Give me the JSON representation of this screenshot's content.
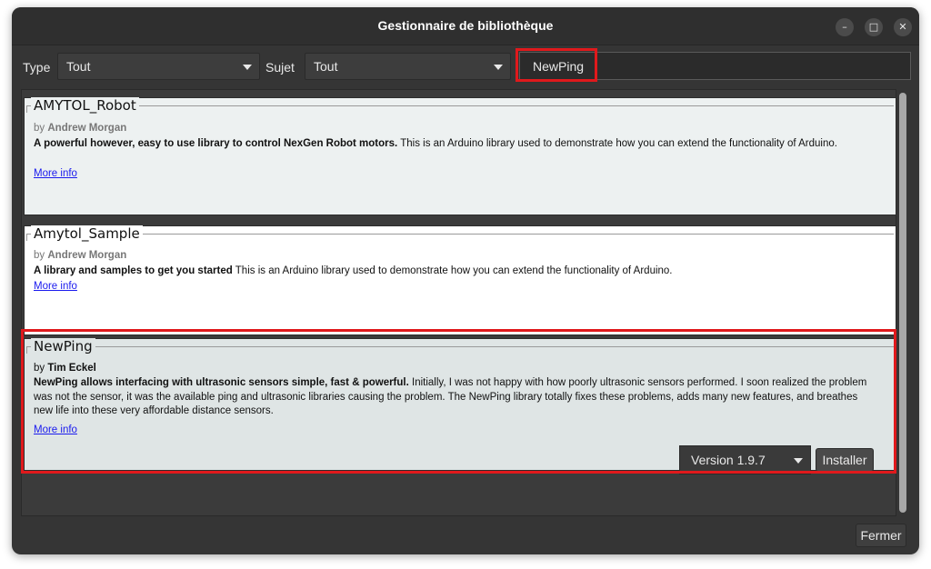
{
  "window": {
    "title": "Gestionnaire de bibliothèque",
    "controls": {
      "minimize": "–",
      "maximize": "□",
      "close": "✕"
    }
  },
  "toolbar": {
    "type_label": "Type",
    "type_value": "Tout",
    "subject_label": "Sujet",
    "subject_value": "Tout",
    "search_value": "NewPing"
  },
  "libraries": [
    {
      "name": "AMYTOL_Robot",
      "by_prefix": "by",
      "author": "Andrew Morgan",
      "summary": "A powerful however, easy to use library to control NexGen Robot motors.",
      "description": "This is an Arduino library used to demonstrate how you can extend the functionality of Arduino.",
      "more_info": "More info"
    },
    {
      "name": "Amytol_Sample",
      "by_prefix": "by",
      "author": "Andrew Morgan",
      "summary": "A library and samples to get you started",
      "description": "This is an Arduino library used to demonstrate how you can extend the functionality of Arduino.",
      "more_info": "More info"
    },
    {
      "name": "NewPing",
      "by_prefix": "by",
      "author": "Tim Eckel",
      "summary": "NewPing allows interfacing with ultrasonic sensors simple, fast & powerful.",
      "description": "Initially, I was not happy with how poorly ultrasonic sensors performed. I soon realized the problem was not the sensor, it was the available ping and ultrasonic libraries causing the problem. The NewPing library totally fixes these problems, adds many new features, and breathes new life into these very affordable distance sensors.",
      "more_info": "More info",
      "version": "Version 1.9.7",
      "install_label": "Installer"
    }
  ],
  "footer": {
    "close_label": "Fermer"
  },
  "colors": {
    "highlight": "#e0191c",
    "link": "#1a1aee",
    "window_bg": "#353535"
  }
}
